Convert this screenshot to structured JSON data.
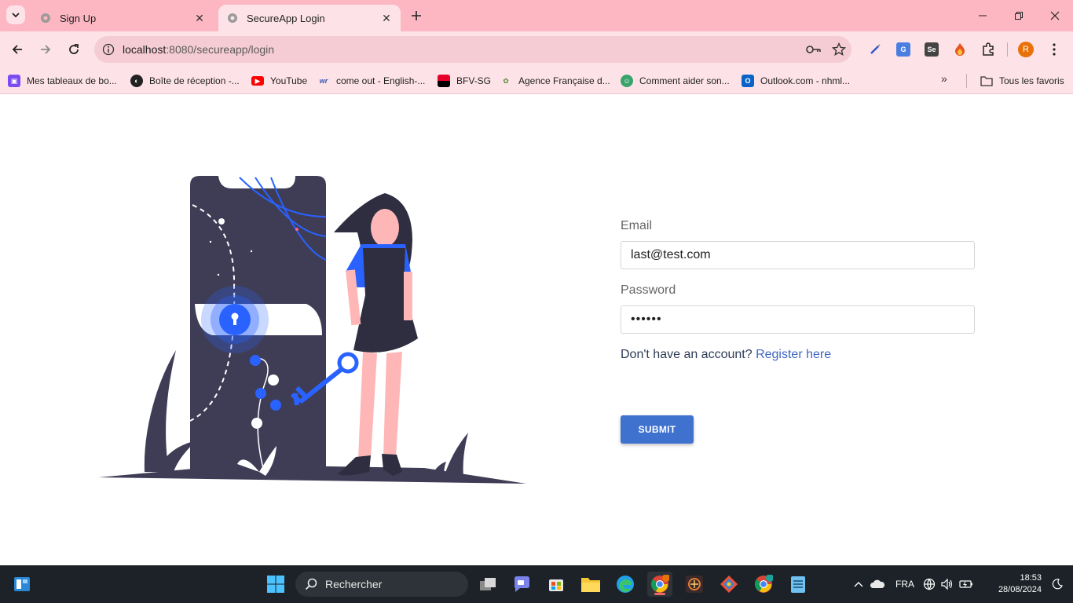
{
  "browser": {
    "tabs": [
      {
        "title": "Sign Up",
        "active": false
      },
      {
        "title": "SecureApp Login",
        "active": true
      }
    ],
    "url_host": "localhost",
    "url_rest": ":8080/secureapp/login",
    "profile_initial": "R",
    "bookmarks": [
      {
        "label": "Mes tableaux de bo...",
        "icon": "trello-icon",
        "color": "#7b4cf0"
      },
      {
        "label": "Boîte de réception -...",
        "icon": "globe-icon",
        "color": "#222222"
      },
      {
        "label": "YouTube",
        "icon": "youtube-icon",
        "color": "#ff0000"
      },
      {
        "label": "come out - English-...",
        "icon": "wordreference-icon",
        "color": "#3355aa"
      },
      {
        "label": "BFV-SG",
        "icon": "sg-bank-icon",
        "color": "#e60028"
      },
      {
        "label": "Agence Française d...",
        "icon": "afd-icon",
        "color": "#5a8c3a"
      },
      {
        "label": "Comment aider son...",
        "icon": "site-icon",
        "color": "#3aa36b"
      },
      {
        "label": "Outlook.com - nhml...",
        "icon": "outlook-icon",
        "color": "#0a64c8"
      }
    ],
    "all_bookmarks_label": "Tous les favoris"
  },
  "login": {
    "email_label": "Email",
    "email_value": "last@test.com",
    "password_label": "Password",
    "password_value": "••••••",
    "register_prompt": "Don't have an account?",
    "register_link": "Register here",
    "submit_label": "SUBMIT"
  },
  "taskbar": {
    "search_placeholder": "Rechercher",
    "language": "FRA",
    "time": "18:53",
    "date": "28/08/2024"
  },
  "colors": {
    "tab_strip": "#fdb7c2",
    "toolbar": "#fde3e8",
    "accent": "#3f72cf",
    "illustration_dark": "#3f3d56",
    "illustration_blue": "#2962ff"
  }
}
